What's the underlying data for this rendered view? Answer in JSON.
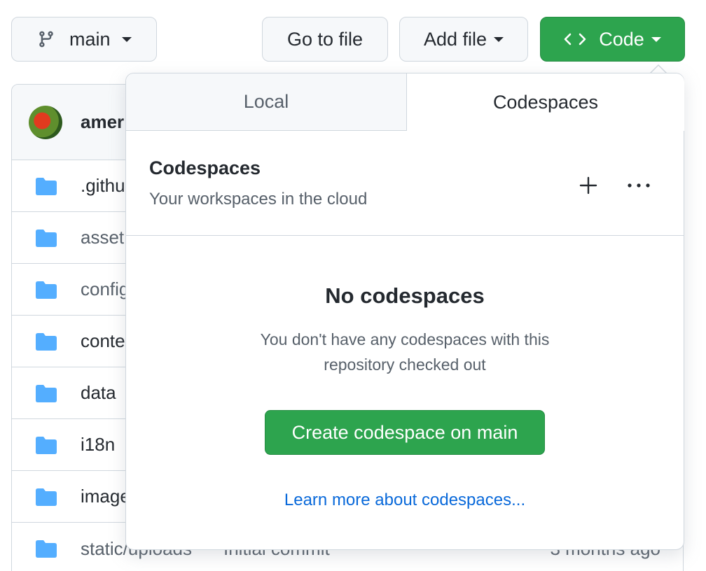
{
  "toolbar": {
    "branch_label": "main",
    "goto_label": "Go to file",
    "add_file_label": "Add file",
    "code_label": "Code"
  },
  "icons": {
    "branch": "git-branch-icon",
    "code": "code-icon",
    "folder": "folder-icon",
    "plus": "plus-icon",
    "more": "kebab-horizontal-icon"
  },
  "colors": {
    "primary_green": "#2da44e",
    "link_blue": "#0969da",
    "folder_blue": "#54aeff"
  },
  "file_list": {
    "author_partial": "amer",
    "rows": [
      {
        "name": ".githu",
        "muted": false,
        "message": "",
        "age": ""
      },
      {
        "name": "asset",
        "muted": true,
        "message": "",
        "age": ""
      },
      {
        "name": "config",
        "muted": true,
        "message": "",
        "age": ""
      },
      {
        "name": "conte",
        "muted": false,
        "message": "",
        "age": ""
      },
      {
        "name": "data",
        "muted": false,
        "message": "",
        "age": ""
      },
      {
        "name": "i18n",
        "muted": false,
        "message": "",
        "age": ""
      },
      {
        "name": "image",
        "muted": false,
        "message": "",
        "age": ""
      },
      {
        "name": "static/uploads",
        "muted": true,
        "message": "Initial commit",
        "age": "3 months ago"
      }
    ]
  },
  "panel": {
    "tabs": [
      {
        "label": "Local",
        "selected": false
      },
      {
        "label": "Codespaces",
        "selected": true
      }
    ],
    "header_title": "Codespaces",
    "header_subtitle": "Your workspaces in the cloud",
    "empty_title": "No codespaces",
    "empty_description": "You don't have any codespaces with this repository checked out",
    "create_button_label": "Create codespace on main",
    "learn_more_link": "Learn more about codespaces..."
  }
}
